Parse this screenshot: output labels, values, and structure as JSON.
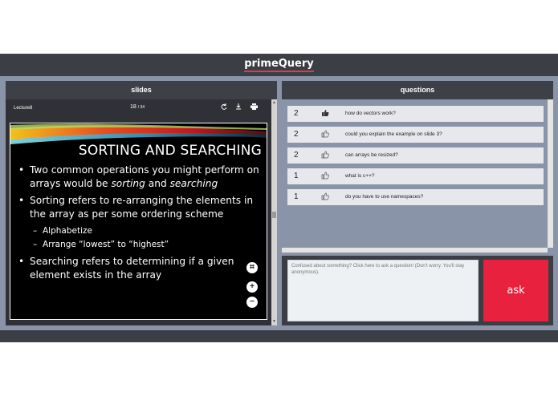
{
  "app": {
    "title": "primeQuery"
  },
  "slides": {
    "header": "slides",
    "file_name": "Lecture8",
    "page_current": "18",
    "page_separator": "/",
    "page_total": "34",
    "toolbar_icons": [
      "rotate-icon",
      "download-icon",
      "print-icon"
    ],
    "slide": {
      "title": "SORTING AND SEARCHING",
      "bullet1_a": "Two common operations you might perform on arrays would be ",
      "bullet1_em1": "sorting",
      "bullet1_and": " and ",
      "bullet1_em2": "searching",
      "bullet2": "Sorting refers to re-arranging the elements in the array as per some ordering scheme",
      "sub1": "Alphabetize",
      "sub2": "Arrange “lowest” to “highest”",
      "bullet3": "Searching refers to determining if a given element exists in the array"
    },
    "zoom": {
      "fit": "⌗",
      "in": "+",
      "out": "−"
    }
  },
  "questions": {
    "header": "questions",
    "items": [
      {
        "votes": "2",
        "text": "how do vectors work?",
        "liked": true
      },
      {
        "votes": "2",
        "text": "could you explain the example on slide 3?",
        "liked": false
      },
      {
        "votes": "2",
        "text": "can arrays be resized?",
        "liked": false
      },
      {
        "votes": "1",
        "text": "what is c++?",
        "liked": false
      },
      {
        "votes": "1",
        "text": "do you have to use namespaces?",
        "liked": false
      }
    ],
    "input_placeholder": "Confused about something? Click here to ask a question! (Don't worry. You'll stay anonymous).",
    "ask_label": "ask"
  },
  "colors": {
    "accent": "#e8213e",
    "bar": "#3b3e44",
    "background": "#8a94a8"
  }
}
